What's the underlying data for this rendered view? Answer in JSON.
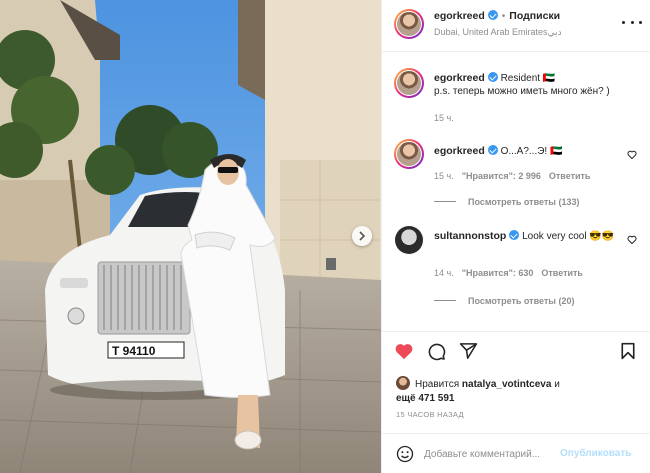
{
  "header": {
    "username": "egorkreed",
    "separator": "•",
    "follow_label": "Подписки",
    "location": "Dubai, United Arab Emiratesدبي"
  },
  "caption": {
    "username": "egorkreed",
    "text_line1": "Resident 🇦🇪",
    "text_line2": "p.s. теперь можно иметь много жён? )",
    "time": "15 ч."
  },
  "comments": [
    {
      "username": "egorkreed",
      "text": "О...А?...Э! 🇦🇪",
      "time": "15 ч.",
      "likes": "\"Нравится\": 2 996",
      "reply_label": "Ответить",
      "view_replies": "Посмотреть ответы (133)"
    },
    {
      "username": "sultannonstop",
      "text": "Look very cool 😎😎",
      "time": "14 ч.",
      "likes": "\"Нравится\": 630",
      "reply_label": "Ответить",
      "view_replies": "Посмотреть ответы (20)"
    }
  ],
  "likes": {
    "prefix": "Нравится",
    "user": "natalya_votintceva",
    "conjunction": "и",
    "more": "ещё 471 591"
  },
  "timestamp": "15 ЧАСОВ НАЗАД",
  "add_comment": {
    "placeholder": "Добавьте комментарий...",
    "post_label": "Опубликовать"
  },
  "plate": "T 94110",
  "icons": [
    "heart-icon",
    "comment-icon",
    "share-icon",
    "bookmark-icon",
    "emoji-icon",
    "more-icon",
    "chevron-right-icon",
    "verified-icon"
  ],
  "colors": {
    "like_red": "#ed4956",
    "link_blue": "#3897f0",
    "post_disabled": "#b2dffc"
  }
}
